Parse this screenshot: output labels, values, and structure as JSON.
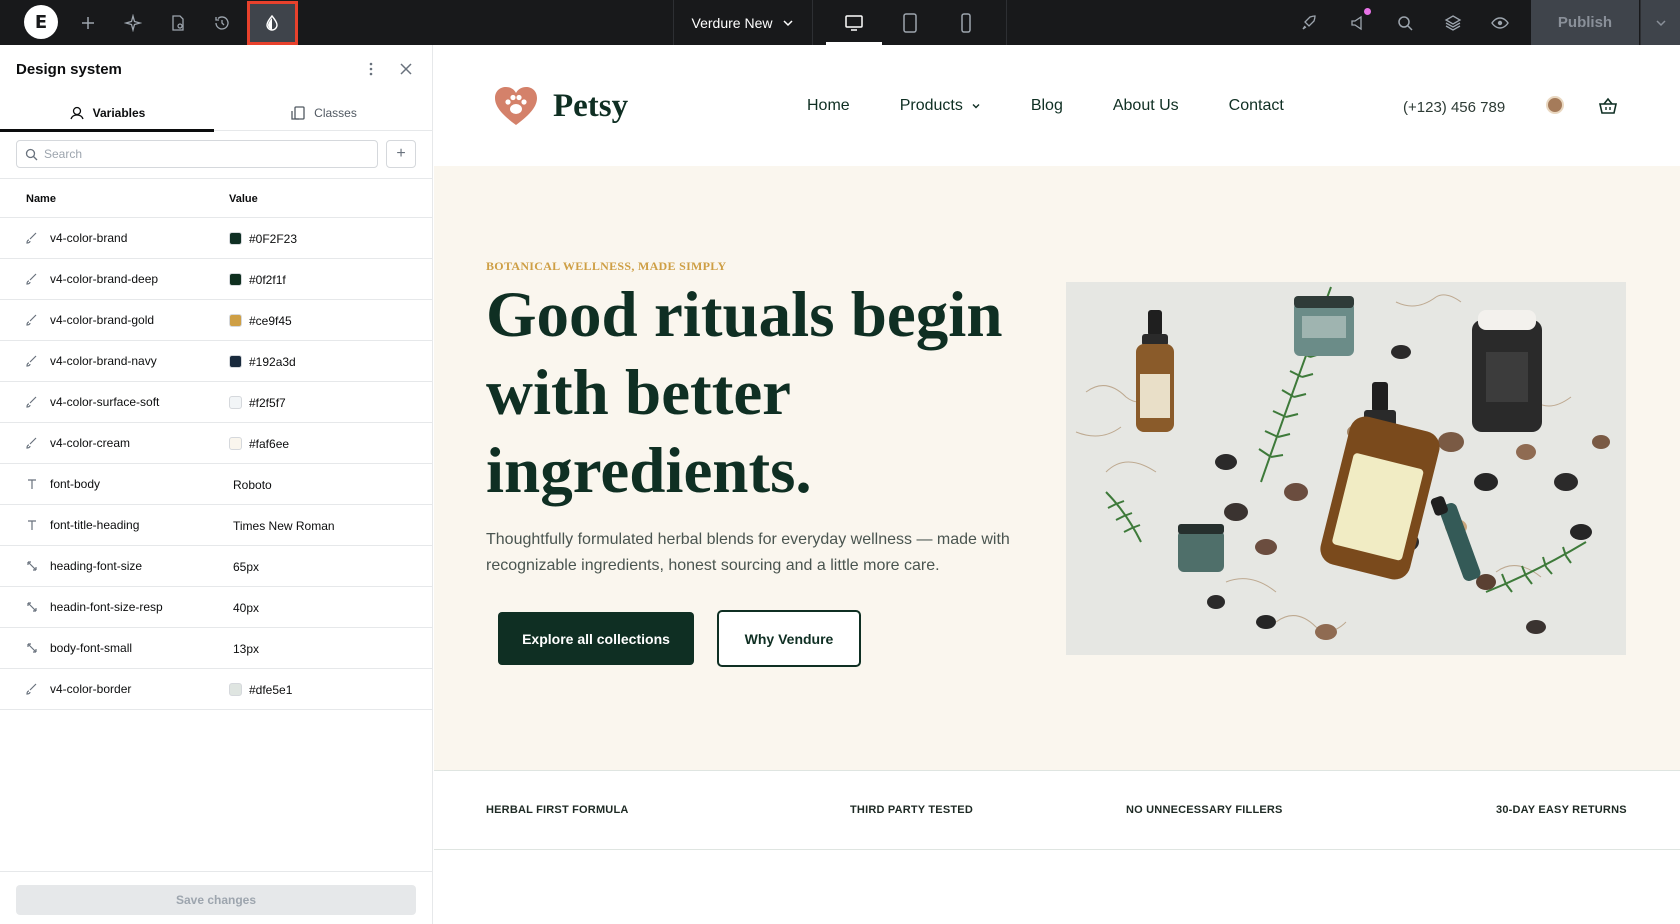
{
  "topbar": {
    "logo_letter": "E",
    "site_name": "Verdure New",
    "publish_label": "Publish"
  },
  "panel": {
    "title": "Design system",
    "tabs": [
      {
        "label": "Variables"
      },
      {
        "label": "Classes"
      }
    ],
    "search_placeholder": "Search",
    "columns": {
      "name": "Name",
      "value": "Value"
    },
    "variables": [
      {
        "type": "color",
        "icon": "brush-icon",
        "name": "v4-color-brand",
        "value": "#0F2F23",
        "swatch": "#0F2F23"
      },
      {
        "type": "color",
        "icon": "brush-icon",
        "name": "v4-color-brand-deep",
        "value": "#0f2f1f",
        "swatch": "#0f2f1f"
      },
      {
        "type": "color",
        "icon": "brush-icon",
        "name": "v4-color-brand-gold",
        "value": "#ce9f45",
        "swatch": "#ce9f45"
      },
      {
        "type": "color",
        "icon": "brush-icon",
        "name": "v4-color-brand-navy",
        "value": "#192a3d",
        "swatch": "#192a3d"
      },
      {
        "type": "color",
        "icon": "brush-icon",
        "name": "v4-color-surface-soft",
        "value": "#f2f5f7",
        "swatch": "#f2f5f7"
      },
      {
        "type": "color",
        "icon": "brush-icon",
        "name": "v4-color-cream",
        "value": "#faf6ee",
        "swatch": "#faf6ee"
      },
      {
        "type": "font",
        "icon": "text-icon",
        "name": "font-body",
        "value": "Roboto"
      },
      {
        "type": "font",
        "icon": "text-icon",
        "name": "font-title-heading",
        "value": "Times New Roman"
      },
      {
        "type": "size",
        "icon": "resize-icon",
        "name": "heading-font-size",
        "value": "65px"
      },
      {
        "type": "size",
        "icon": "resize-icon",
        "name": "headin-font-size-resp",
        "value": "40px"
      },
      {
        "type": "size",
        "icon": "resize-icon",
        "name": "body-font-small",
        "value": "13px"
      },
      {
        "type": "color",
        "icon": "brush-icon",
        "name": "v4-color-border",
        "value": "#dfe5e1",
        "swatch": "#dfe5e1"
      }
    ],
    "save_label": "Save changes"
  },
  "site": {
    "brand": "Petsy",
    "nav": [
      {
        "label": "Home"
      },
      {
        "label": "Products",
        "has_dropdown": true
      },
      {
        "label": "Blog"
      },
      {
        "label": "About Us"
      },
      {
        "label": "Contact"
      }
    ],
    "phone": "(+123) 456 789",
    "hero": {
      "eyebrow": "BOTANICAL WELLNESS, MADE SIMPLY",
      "headline": "Good rituals begin with better ingredients.",
      "subtitle": "Thoughtfully formulated herbal blends for everyday wellness — made with recognizable ingredients, honest sourcing and a little more care.",
      "primary_cta": "Explore all collections",
      "secondary_cta": "Why Vendure"
    },
    "features": [
      "HERBAL FIRST FORMULA",
      "THIRD PARTY TESTED",
      "NO UNNECESSARY FILLERS",
      "30-DAY EASY RETURNS"
    ]
  },
  "colors": {
    "brand": "#0f2f23",
    "gold": "#ce9f45",
    "cream": "#faf6ee",
    "highlight": "#e8412c",
    "topbar": "#18191b"
  }
}
